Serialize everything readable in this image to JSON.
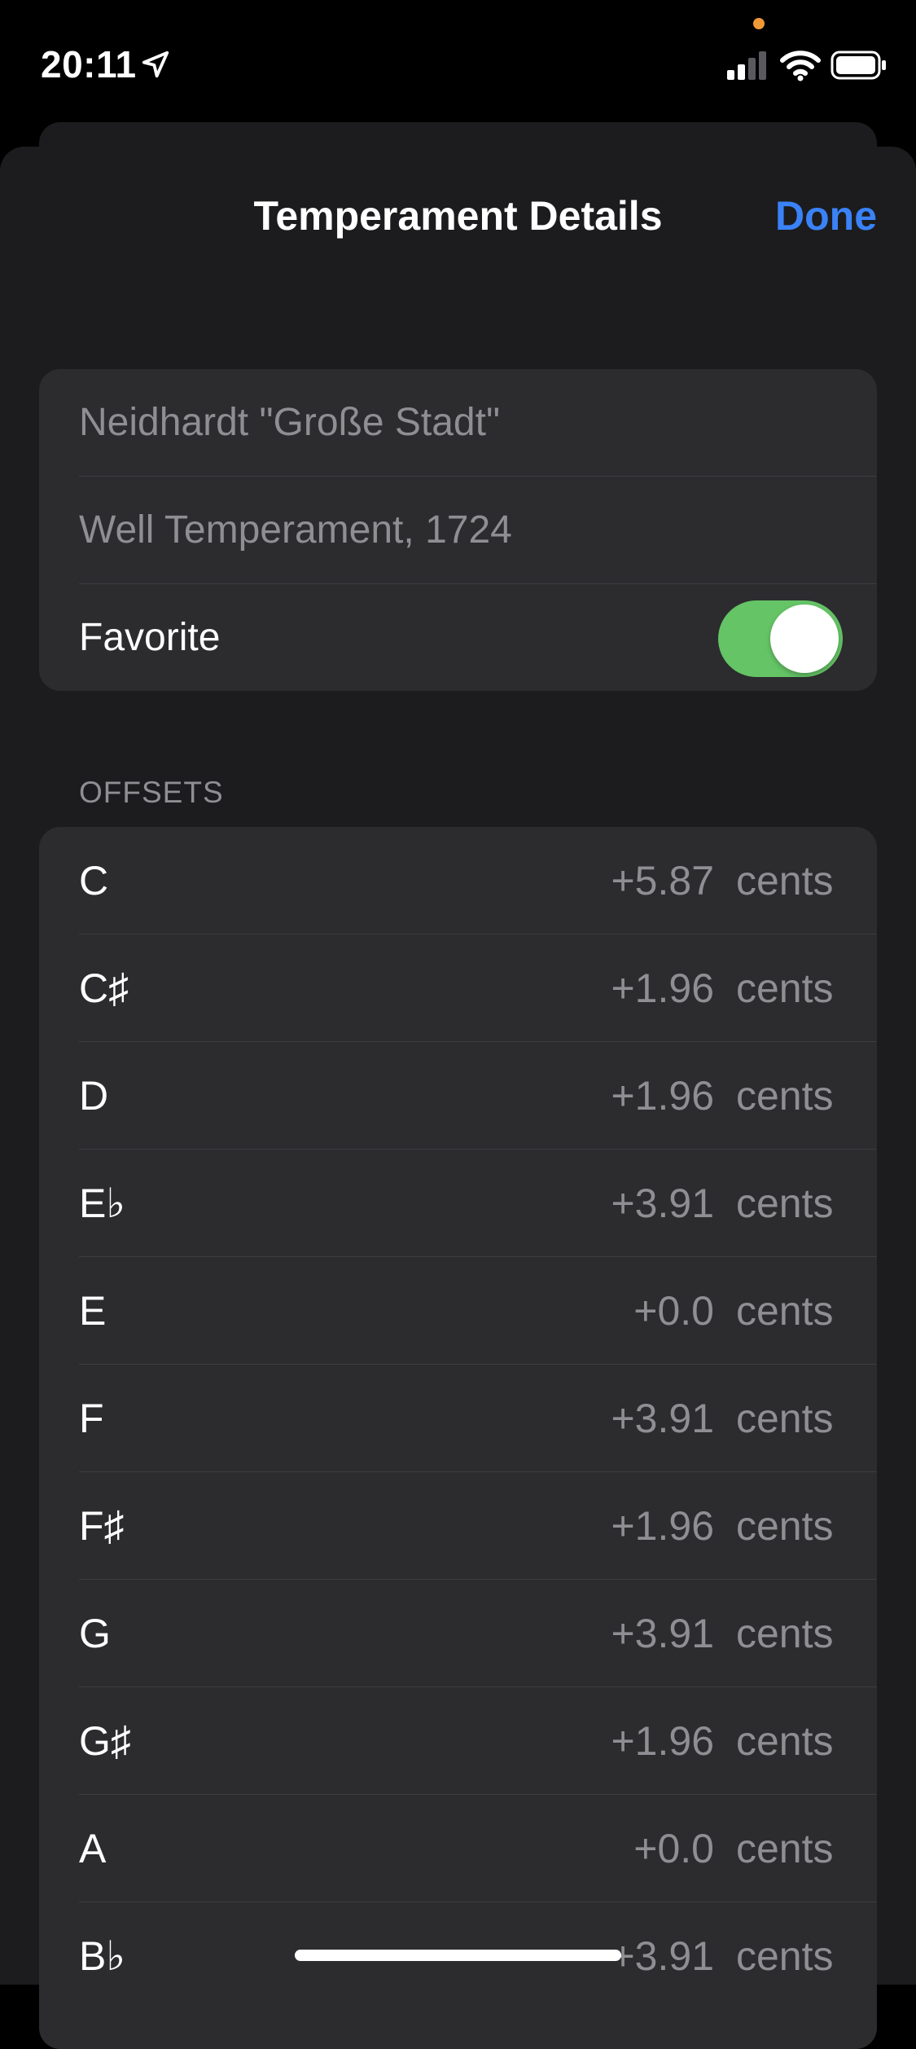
{
  "status_bar": {
    "time": "20:11",
    "icons": [
      "location-arrow-icon",
      "signal-icon",
      "wifi-icon",
      "battery-icon"
    ]
  },
  "nav": {
    "title": "Temperament Details",
    "done_label": "Done"
  },
  "details": {
    "name": "Neidhardt \"Große Stadt\"",
    "description": "Well Temperament, 1724",
    "favorite_label": "Favorite",
    "favorite_on": true
  },
  "offsets": {
    "header": "OFFSETS",
    "unit": "cents",
    "rows": [
      {
        "note": "C",
        "value": "+5.87"
      },
      {
        "note": "C♯",
        "value": "+1.96"
      },
      {
        "note": "D",
        "value": "+1.96"
      },
      {
        "note": "E♭",
        "value": "+3.91"
      },
      {
        "note": "E",
        "value": "+0.0"
      },
      {
        "note": "F",
        "value": "+3.91"
      },
      {
        "note": "F♯",
        "value": "+1.96"
      },
      {
        "note": "G",
        "value": "+3.91"
      },
      {
        "note": "G♯",
        "value": "+1.96"
      },
      {
        "note": "A",
        "value": "+0.0"
      },
      {
        "note": "B♭",
        "value": "+3.91"
      }
    ]
  },
  "colors": {
    "accent": "#3a82f7",
    "toggle_on": "#65c466",
    "background": "#000000",
    "sheet": "#1c1c1e",
    "cell": "#2c2c2e",
    "secondary_text": "#8e8e93"
  }
}
